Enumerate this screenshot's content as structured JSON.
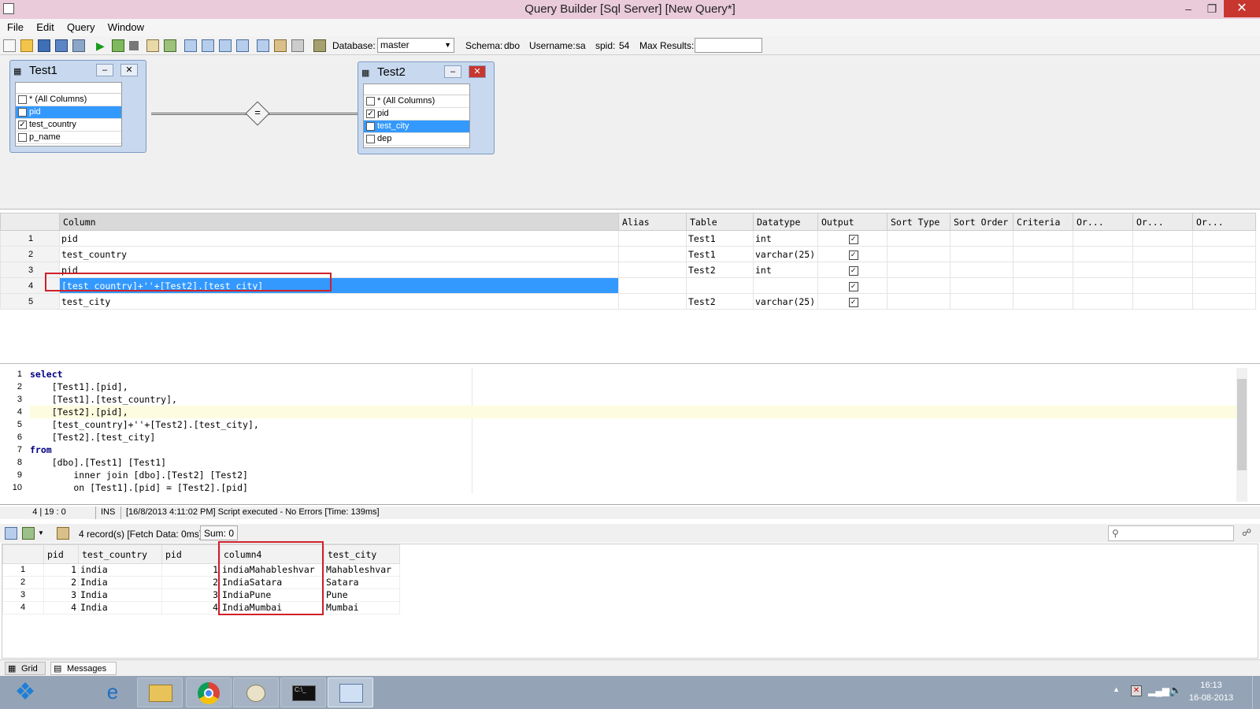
{
  "window": {
    "title": "Query Builder [Sql Server] [New Query*]"
  },
  "menu": [
    "File",
    "Edit",
    "Query",
    "Window"
  ],
  "toolbar": {
    "database_label": "Database:",
    "database_value": "master",
    "schema_label": "Schema:",
    "schema_value": "dbo",
    "username_label": "Username:",
    "username_value": "sa",
    "spid_label": "spid:",
    "spid_value": "54",
    "maxresults_label": "Max Results:"
  },
  "diagram": {
    "tables": [
      {
        "name": "Test1",
        "columns": [
          {
            "label": "* (All Columns)",
            "checked": false,
            "selected": false
          },
          {
            "label": "pid",
            "checked": true,
            "selected": true
          },
          {
            "label": "test_country",
            "checked": true,
            "selected": false
          },
          {
            "label": "p_name",
            "checked": false,
            "selected": false
          }
        ]
      },
      {
        "name": "Test2",
        "columns": [
          {
            "label": "* (All Columns)",
            "checked": false,
            "selected": false
          },
          {
            "label": "pid",
            "checked": true,
            "selected": false
          },
          {
            "label": "test_city",
            "checked": true,
            "selected": true
          },
          {
            "label": "dep",
            "checked": false,
            "selected": false
          }
        ]
      }
    ],
    "join_symbol": "="
  },
  "query_grid": {
    "headers": [
      "Column",
      "Alias",
      "Table",
      "Datatype",
      "Output",
      "Sort Type",
      "Sort Order",
      "Criteria",
      "Or...",
      "Or...",
      "Or..."
    ],
    "rows": [
      {
        "num": "1",
        "column": "pid",
        "table": "Test1",
        "datatype": "int",
        "output": true
      },
      {
        "num": "2",
        "column": "test_country",
        "table": "Test1",
        "datatype": "varchar(25)",
        "output": true
      },
      {
        "num": "3",
        "column": "pid",
        "table": "Test2",
        "datatype": "int",
        "output": true
      },
      {
        "num": "4",
        "column": "[test_country]+''+[Test2].[test_city]",
        "table": "",
        "datatype": "",
        "output": true
      },
      {
        "num": "5",
        "column": "test_city",
        "table": "Test2",
        "datatype": "varchar(25)",
        "output": true
      }
    ]
  },
  "editor": {
    "lines": [
      "select",
      "    [Test1].[pid],",
      "    [Test1].[test_country],",
      "    [Test2].[pid],",
      "    [test_country]+''+[Test2].[test_city],",
      "    [Test2].[test_city]",
      "from",
      "    [dbo].[Test1] [Test1]",
      "        inner join [dbo].[Test2] [Test2]",
      "        on [Test1].[pid] = [Test2].[pid]"
    ]
  },
  "status": {
    "position": "4 | 19 : 0",
    "mode": "INS",
    "message": "[16/8/2013 4:11:02 PM] Script executed - No Errors [Time: 139ms]"
  },
  "results_toolbar": {
    "records": "4 record(s) [Fetch Data: 0ms]",
    "sum": "Sum: 0"
  },
  "results": {
    "headers": [
      "pid",
      "test_country",
      "pid",
      "column4",
      "test_city"
    ],
    "rows": [
      [
        "1",
        "1",
        "india",
        "1",
        "indiaMahableshvar",
        "Mahableshvar"
      ],
      [
        "2",
        "2",
        "India",
        "2",
        "IndiaSatara",
        "Satara"
      ],
      [
        "3",
        "3",
        "India",
        "3",
        "IndiaPune",
        "Pune"
      ],
      [
        "4",
        "4",
        "India",
        "4",
        "IndiaMumbai",
        "Mumbai"
      ]
    ]
  },
  "bottom_tabs": [
    "Grid",
    "Messages"
  ],
  "taskbar": {
    "time": "16:13",
    "date": "16-08-2013"
  }
}
